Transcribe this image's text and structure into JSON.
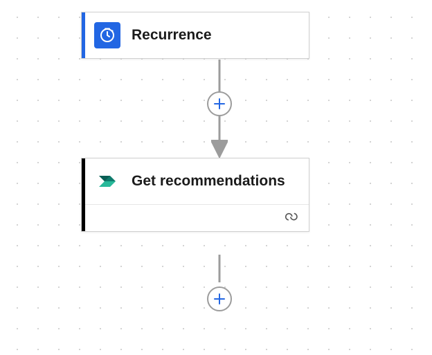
{
  "nodes": {
    "recurrence": {
      "title": "Recurrence",
      "accent_color": "#2266E3",
      "icon_bg": "#2266E3",
      "icon": "clock-icon"
    },
    "get_recommendations": {
      "title": "Get recommendations",
      "accent_color": "#000000",
      "icon_bg": "transparent",
      "icon": "power-automate-icon"
    }
  },
  "add_button_label": "+",
  "connection_icon_label": "link-icon"
}
